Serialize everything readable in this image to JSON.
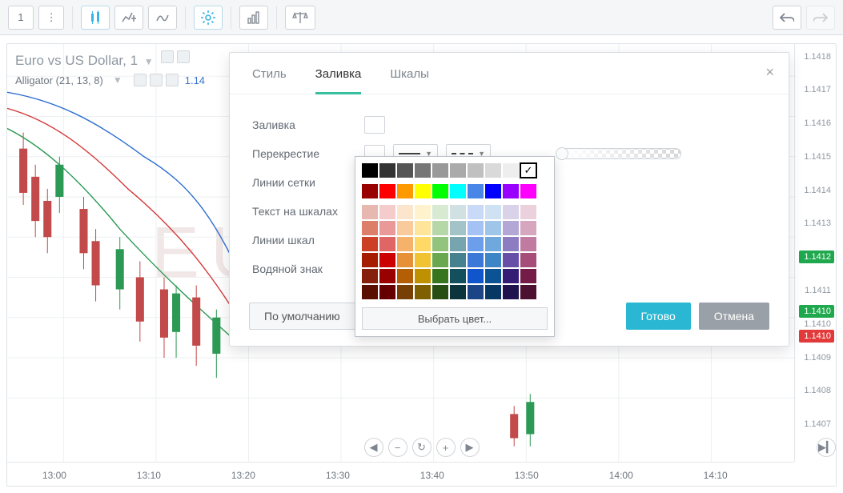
{
  "toolbar": {
    "tf": "1"
  },
  "chart": {
    "title": "Euro vs US Dollar, 1",
    "indicator": "Alligator (21, 13, 8)",
    "quote": "1.14",
    "watermark": "EU"
  },
  "y_ticks": [
    {
      "v": "1.1418",
      "pct": 3
    },
    {
      "v": "1.1417",
      "pct": 11
    },
    {
      "v": "1.1416",
      "pct": 19
    },
    {
      "v": "1.1415",
      "pct": 27
    },
    {
      "v": "1.1414",
      "pct": 35
    },
    {
      "v": "1.1413",
      "pct": 43
    },
    {
      "v": "1.1412",
      "pct": 51
    },
    {
      "v": "1.1411",
      "pct": 59
    },
    {
      "v": "1.1410",
      "pct": 67
    },
    {
      "v": "1.1409",
      "pct": 75
    },
    {
      "v": "1.1408",
      "pct": 83
    },
    {
      "v": "1.1407",
      "pct": 91
    }
  ],
  "prices": [
    {
      "v": "1.1412",
      "pct": 51,
      "cls": "green"
    },
    {
      "v": "1.1410",
      "pct": 64,
      "cls": "green"
    },
    {
      "v": "1.1410",
      "pct": 70,
      "cls": "red"
    }
  ],
  "x_ticks": [
    {
      "v": "13:00",
      "pct": 6
    },
    {
      "v": "13:10",
      "pct": 18
    },
    {
      "v": "13:20",
      "pct": 30
    },
    {
      "v": "13:30",
      "pct": 42
    },
    {
      "v": "13:40",
      "pct": 54
    },
    {
      "v": "13:50",
      "pct": 66
    },
    {
      "v": "14:00",
      "pct": 78
    },
    {
      "v": "14:10",
      "pct": 90
    }
  ],
  "dialog": {
    "tabs": {
      "style": "Стиль",
      "fill": "Заливка",
      "scales": "Шкалы"
    },
    "opts": {
      "fill": "Заливка",
      "crosshair": "Перекрестие",
      "grid": "Линии сетки",
      "scale_text": "Текст на шкалах",
      "scale_lines": "Линии шкал",
      "watermark": "Водяной знак"
    },
    "defaults": "По умолчанию",
    "done": "Готово",
    "cancel": "Отмена"
  },
  "picker": {
    "top_row": [
      "#000000",
      "#333333",
      "#555555",
      "#777777",
      "#999999",
      "#aaaaaa",
      "#c0c0c0",
      "#d9d9d9",
      "#eeeeee",
      "#ffffff"
    ],
    "sat_row": [
      "#990000",
      "#ff0000",
      "#ff9900",
      "#ffff00",
      "#00ff00",
      "#00ffff",
      "#4a86e8",
      "#0000ff",
      "#9900ff",
      "#ff00ff"
    ],
    "grid": [
      [
        "#e6b8af",
        "#f4cccc",
        "#fce5cd",
        "#fff2cc",
        "#d9ead3",
        "#d0e0e3",
        "#c9daf8",
        "#cfe2f3",
        "#d9d2e9",
        "#ead1dc"
      ],
      [
        "#dd7e6b",
        "#ea9999",
        "#f9cb9c",
        "#ffe599",
        "#b6d7a8",
        "#a2c4c9",
        "#a4c2f4",
        "#9fc5e8",
        "#b4a7d6",
        "#d5a6bd"
      ],
      [
        "#cc4125",
        "#e06666",
        "#f6b26b",
        "#ffd966",
        "#93c47d",
        "#76a5af",
        "#6d9eeb",
        "#6fa8dc",
        "#8e7cc3",
        "#c27ba0"
      ],
      [
        "#a61c00",
        "#cc0000",
        "#e69138",
        "#f1c232",
        "#6aa84f",
        "#45818e",
        "#3c78d8",
        "#3d85c6",
        "#674ea7",
        "#a64d79"
      ],
      [
        "#85200c",
        "#990000",
        "#b45f06",
        "#bf9000",
        "#38761d",
        "#134f5c",
        "#1155cc",
        "#0b5394",
        "#351c75",
        "#741b47"
      ],
      [
        "#5b0f00",
        "#660000",
        "#783f04",
        "#7f6000",
        "#274e13",
        "#0c343d",
        "#1c4587",
        "#073763",
        "#20124d",
        "#4c1130"
      ]
    ],
    "custom": "Выбрать цвет...",
    "selected": "#ffffff"
  }
}
